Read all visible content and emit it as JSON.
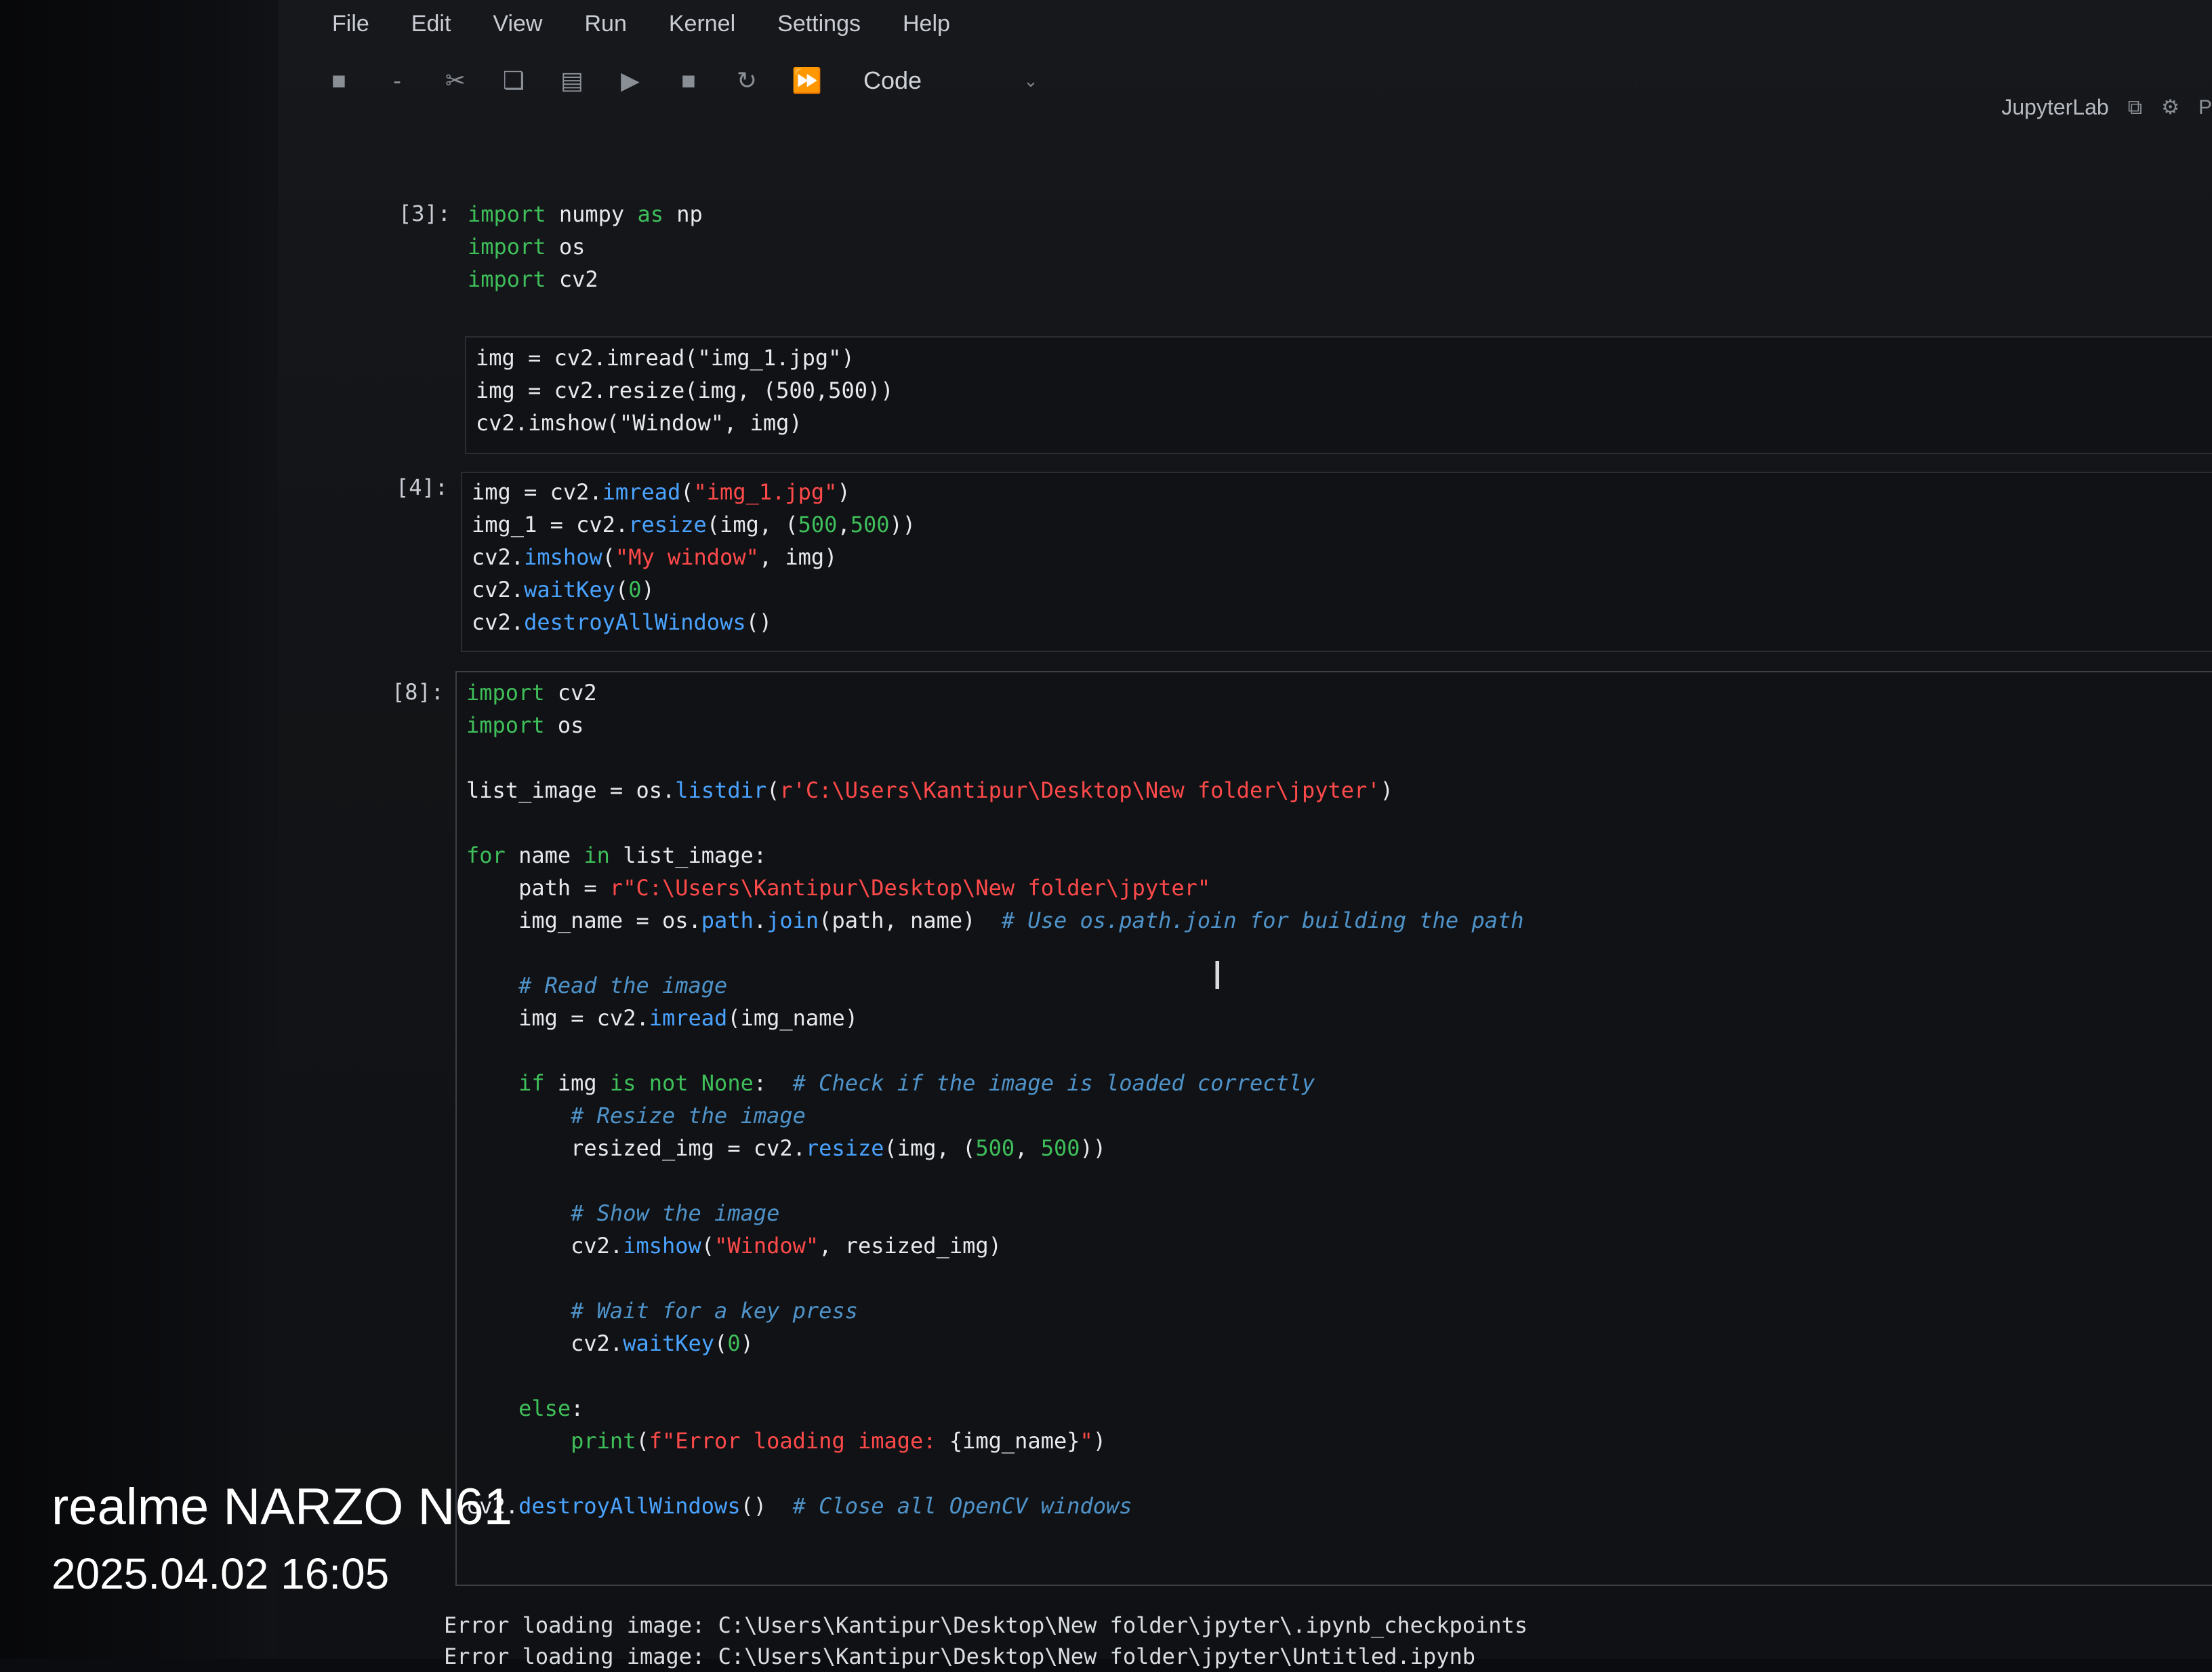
{
  "menubar": {
    "items": [
      "File",
      "Edit",
      "View",
      "Run",
      "Kernel",
      "Settings",
      "Help"
    ]
  },
  "toolbar": {
    "icons": [
      "save-icon",
      "add-icon",
      "cut-icon",
      "copy-icon",
      "paste-icon",
      "run-icon",
      "stop-icon",
      "restart-icon",
      "run-all-icon"
    ],
    "cell_type": "Code"
  },
  "kernel_area": {
    "label": "JupyterLab"
  },
  "cells": [
    {
      "prompt": "[3]:",
      "lines": [
        "import numpy as np",
        "import os",
        "import cv2"
      ]
    },
    {
      "prompt": "",
      "lines": [
        "img = cv2.imread(\"img_1.jpg\")",
        "img = cv2.resize(img, (500,500))",
        "cv2.imshow(\"Window\", img)"
      ]
    },
    {
      "prompt": "[4]:",
      "lines": [
        "img = cv2.imread(\"img_1.jpg\")",
        "img_1 = cv2.resize(img, (500,500))",
        "cv2.imshow(\"My window\", img)",
        "cv2.waitKey(0)",
        "cv2.destroyAllWindows()"
      ]
    },
    {
      "prompt": "[8]:",
      "lines": [
        "import cv2",
        "import os",
        "",
        "list_image = os.listdir(r'C:\\Users\\Kantipur\\Desktop\\New folder\\jpyter')",
        "",
        "for name in list_image:",
        "    path = r\"C:\\Users\\Kantipur\\Desktop\\New folder\\jpyter\"",
        "    img_name = os.path.join(path, name)  # Use os.path.join for building the path",
        "",
        "    # Read the image",
        "    img = cv2.imread(img_name)",
        "",
        "    if img is not None:  # Check if the image is loaded correctly",
        "        # Resize the image",
        "        resized_img = cv2.resize(img, (500, 500))",
        "",
        "        # Show the image",
        "        cv2.imshow(\"Window\", resized_img)",
        "",
        "        # Wait for a key press",
        "        cv2.waitKey(0)",
        "",
        "    else:",
        "        print(f\"Error loading image: {img_name}\")",
        "",
        "cv2.destroyAllWindows()  # Close all OpenCV windows"
      ]
    }
  ],
  "output": {
    "lines": [
      "Error loading image: C:\\Users\\Kantipur\\Desktop\\New folder\\jpyter\\.ipynb_checkpoints",
      "Error loading image: C:\\Users\\Kantipur\\Desktop\\New folder\\jpyter\\Untitled.ipynb"
    ]
  },
  "watermark": {
    "device": "realme NARZO N61",
    "timestamp": "2025.04.02 16:05"
  }
}
